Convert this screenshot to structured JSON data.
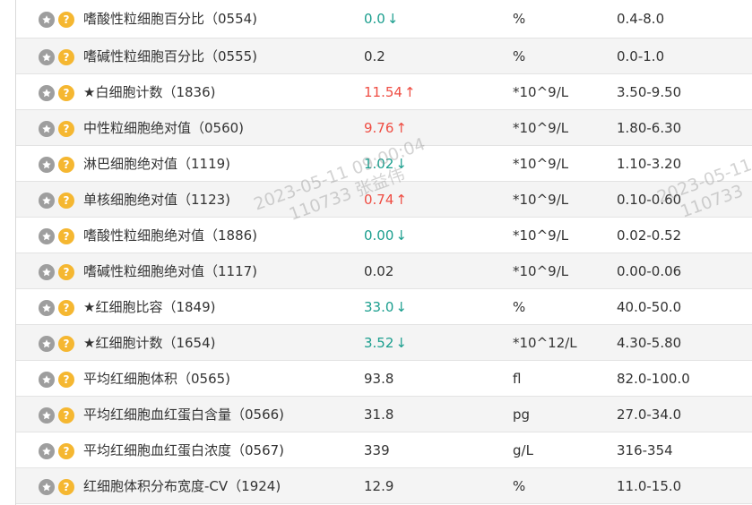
{
  "table": {
    "rows": [
      {
        "name": "嗜酸性粒细胞百分比（0554)",
        "value": "0.0",
        "flag": "low",
        "arrow": "↓",
        "unit": "%",
        "range": "0.4-8.0"
      },
      {
        "name": "嗜碱性粒细胞百分比（0555)",
        "value": "0.2",
        "flag": "normal",
        "arrow": "",
        "unit": "%",
        "range": "0.0-1.0"
      },
      {
        "name": "★白细胞计数（1836)",
        "value": "11.54",
        "flag": "high",
        "arrow": "↑",
        "unit": "*10^9/L",
        "range": "3.50-9.50"
      },
      {
        "name": "中性粒细胞绝对值（0560)",
        "value": "9.76",
        "flag": "high",
        "arrow": "↑",
        "unit": "*10^9/L",
        "range": "1.80-6.30"
      },
      {
        "name": "淋巴细胞绝对值（1119)",
        "value": "1.02",
        "flag": "low",
        "arrow": "↓",
        "unit": "*10^9/L",
        "range": "1.10-3.20"
      },
      {
        "name": "单核细胞绝对值（1123)",
        "value": "0.74",
        "flag": "high",
        "arrow": "↑",
        "unit": "*10^9/L",
        "range": "0.10-0.60"
      },
      {
        "name": "嗜酸性粒细胞绝对值（1886)",
        "value": "0.00",
        "flag": "low",
        "arrow": "↓",
        "unit": "*10^9/L",
        "range": "0.02-0.52"
      },
      {
        "name": "嗜碱性粒细胞绝对值（1117)",
        "value": "0.02",
        "flag": "normal",
        "arrow": "",
        "unit": "*10^9/L",
        "range": "0.00-0.06"
      },
      {
        "name": "★红细胞比容（1849)",
        "value": "33.0",
        "flag": "low",
        "arrow": "↓",
        "unit": "%",
        "range": "40.0-50.0"
      },
      {
        "name": "★红细胞计数（1654)",
        "value": "3.52",
        "flag": "low",
        "arrow": "↓",
        "unit": "*10^12/L",
        "range": "4.30-5.80"
      },
      {
        "name": "平均红细胞体积（0565)",
        "value": "93.8",
        "flag": "normal",
        "arrow": "",
        "unit": "fl",
        "range": "82.0-100.0"
      },
      {
        "name": "平均红细胞血红蛋白含量（0566)",
        "value": "31.8",
        "flag": "normal",
        "arrow": "",
        "unit": "pg",
        "range": "27.0-34.0"
      },
      {
        "name": "平均红细胞血红蛋白浓度（0567)",
        "value": "339",
        "flag": "normal",
        "arrow": "",
        "unit": "g/L",
        "range": "316-354"
      },
      {
        "name": "红细胞体积分布宽度-CV（1924)",
        "value": "12.9",
        "flag": "normal",
        "arrow": "",
        "unit": "%",
        "range": "11.0-15.0"
      }
    ]
  },
  "icons": {
    "star": "star-icon",
    "help": "help-icon",
    "help_glyph": "?"
  },
  "colors": {
    "low": "#1b9e8e",
    "high": "#ef4d43",
    "normal": "#333333",
    "help_icon": "#f5b731",
    "star_icon": "#9e9e9e"
  },
  "watermark": {
    "line1": "2023-05-11 09:00:04",
    "line2": "110733 张益伟",
    "line1_partial": "2023-05-11",
    "line2_partial": "110733"
  }
}
